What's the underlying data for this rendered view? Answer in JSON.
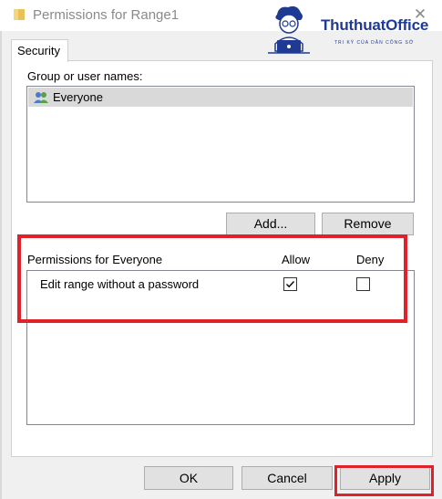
{
  "window": {
    "title": "Permissions for Range1",
    "close_glyph": "✕",
    "icon": "folder-icon"
  },
  "logo": {
    "name": "ThuthuatOffice",
    "tagline": "TRI KỲ CỦA DÂN CÔNG SỞ"
  },
  "tabs": [
    {
      "label": "Security"
    }
  ],
  "group": {
    "label": "Group or user names:",
    "users": [
      {
        "name": "Everyone",
        "icon": "users-icon",
        "selected": true
      }
    ]
  },
  "buttons": {
    "add": "Add...",
    "remove": "Remove",
    "ok": "OK",
    "cancel": "Cancel",
    "apply": "Apply"
  },
  "permissions": {
    "label": "Permissions for Everyone",
    "allow_header": "Allow",
    "deny_header": "Deny",
    "rows": [
      {
        "name": "Edit range without a password",
        "allow": true,
        "deny": false
      }
    ]
  },
  "colors": {
    "highlight": "#e0202a",
    "brand": "#1f3a93"
  }
}
